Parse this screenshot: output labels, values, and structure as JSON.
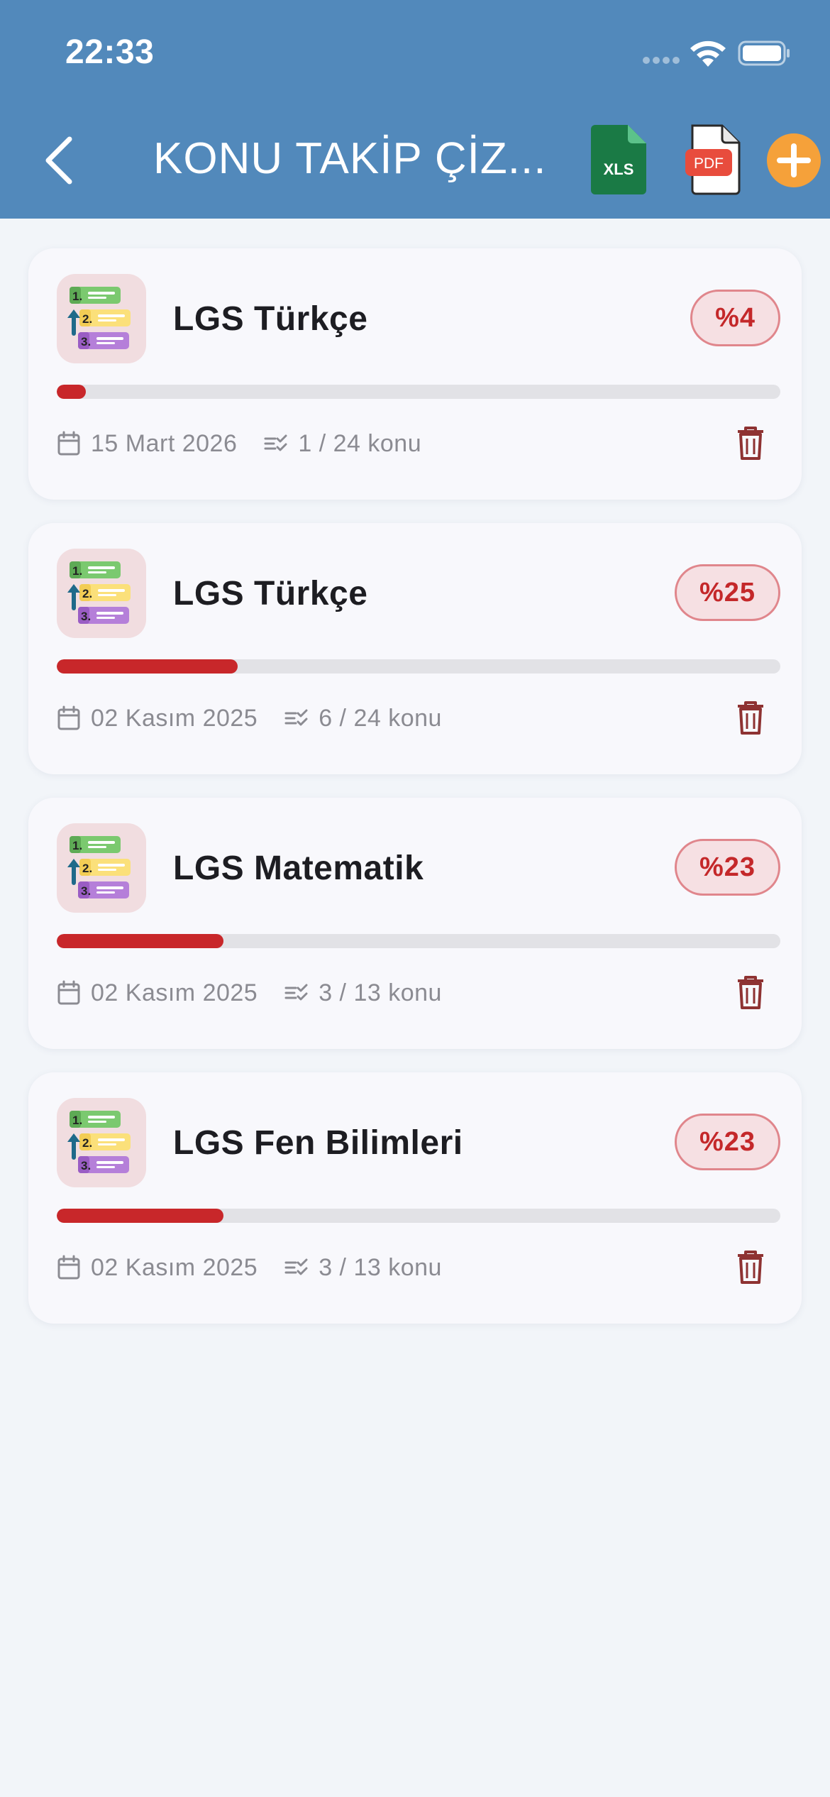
{
  "status_bar": {
    "time": "22:33"
  },
  "header": {
    "title": "KONU TAKİP ÇİZ...",
    "xls_label": "XLS",
    "pdf_label": "PDF"
  },
  "colors": {
    "header": "#5289bb",
    "progress_fill": "#c8272a",
    "badge_text": "#c4282a",
    "add_button": "#f5a13a",
    "xls_green": "#1a7a45",
    "pdf_red": "#e84c3d"
  },
  "icons": {
    "card_icon_labels": [
      "1.",
      "2.",
      "3."
    ]
  },
  "cards": [
    {
      "title": "LGS Türkçe",
      "badge": "%4",
      "progress": 0.04,
      "date": "15 Mart 2026",
      "topics": "1 / 24 konu"
    },
    {
      "title": "LGS Türkçe",
      "badge": "%25",
      "progress": 0.25,
      "date": "02 Kasım 2025",
      "topics": "6 / 24 konu"
    },
    {
      "title": "LGS Matematik",
      "badge": "%23",
      "progress": 0.23,
      "date": "02 Kasım 2025",
      "topics": "3 / 13 konu"
    },
    {
      "title": "LGS Fen Bilimleri",
      "badge": "%23",
      "progress": 0.23,
      "date": "02 Kasım 2025",
      "topics": "3 / 13 konu"
    }
  ]
}
